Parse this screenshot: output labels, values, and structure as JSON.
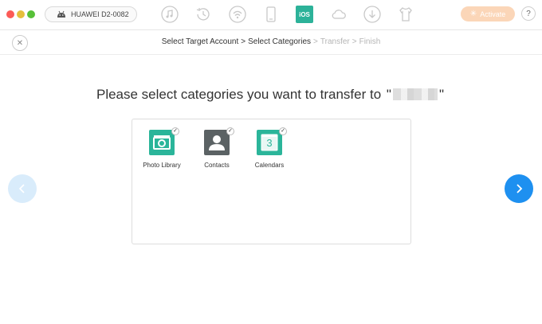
{
  "toolbar": {
    "device_name": "HUAWEI D2-0082",
    "tools": [
      {
        "icon": "music-icon"
      },
      {
        "icon": "history-icon"
      },
      {
        "icon": "wifi-sync-icon"
      },
      {
        "icon": "phone-icon"
      },
      {
        "icon": "ios-mover-icon",
        "label": "iOS"
      },
      {
        "icon": "cloud-icon"
      },
      {
        "icon": "download-icon"
      },
      {
        "icon": "tshirt-icon"
      }
    ],
    "activate_label": "Activate",
    "help_label": "?",
    "accent_color": "#2cb299"
  },
  "breadcrumb": {
    "steps": [
      "Select Target Account",
      "Select Categories",
      "Transfer",
      "Finish"
    ],
    "separator": ">"
  },
  "headline": {
    "text": "Please select categories you want to transfer to",
    "open_quote": "\"",
    "close_quote": "\""
  },
  "categories": [
    {
      "label": "Photo Library",
      "icon": "photo-library-icon",
      "checked": true
    },
    {
      "label": "Contacts",
      "icon": "contacts-icon",
      "checked": true
    },
    {
      "label": "Calendars",
      "icon": "calendar-icon",
      "checked": true,
      "number": "3"
    }
  ],
  "colors": {
    "next_button": "#1e90f0",
    "prev_button": "#d9ecfb"
  }
}
